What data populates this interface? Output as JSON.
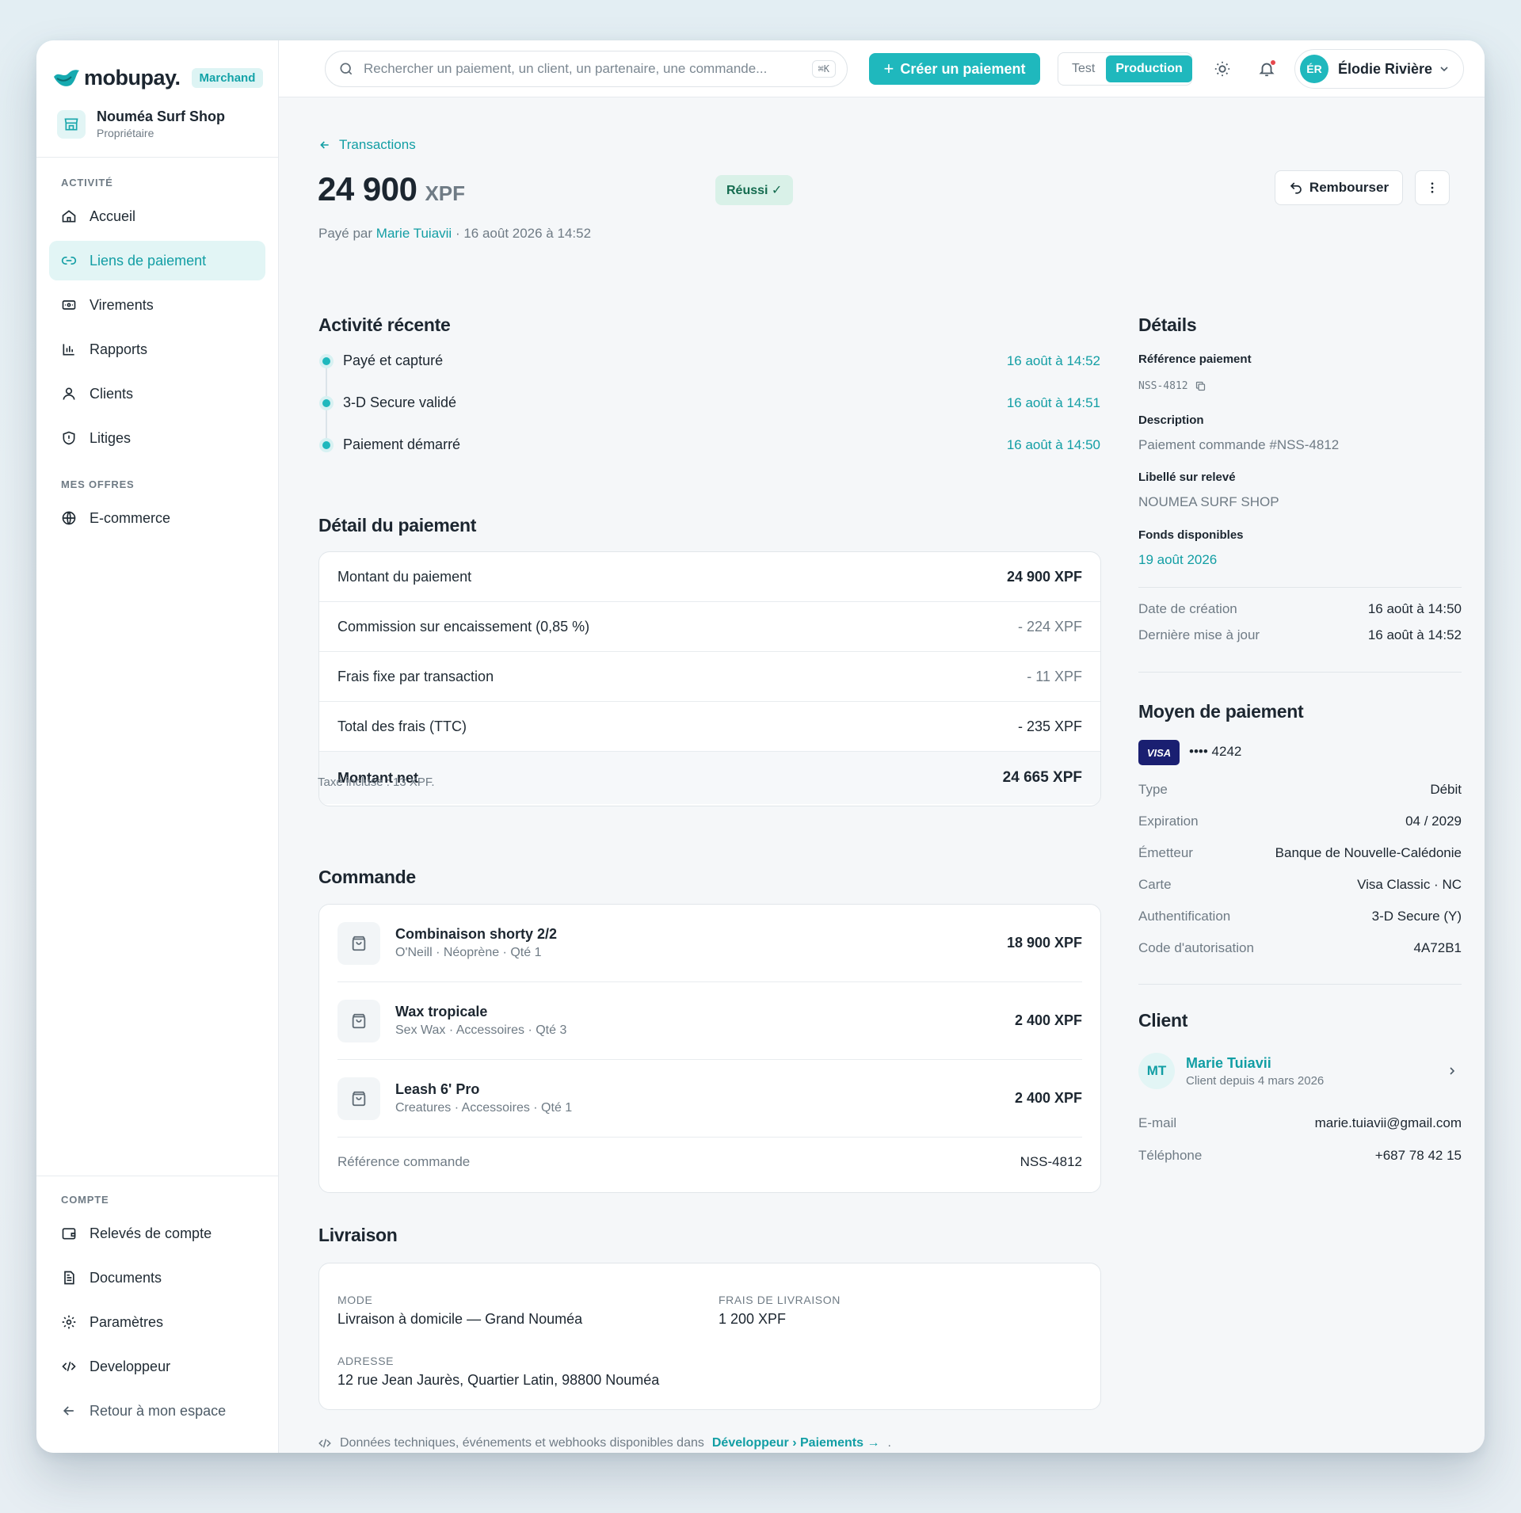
{
  "brand": {
    "name": "mobupay.",
    "badge": "Marchand"
  },
  "shop": {
    "name": "Nouméa Surf Shop",
    "role": "Propriétaire"
  },
  "sidebar": {
    "section_activity": "ACTIVITÉ",
    "items": [
      {
        "label": "Accueil",
        "icon": "home-icon"
      },
      {
        "label": "Liens de paiement",
        "icon": "link-icon",
        "active": true
      },
      {
        "label": "Virements",
        "icon": "transfer-icon"
      },
      {
        "label": "Rapports",
        "icon": "chart-icon"
      },
      {
        "label": "Clients",
        "icon": "user-icon"
      },
      {
        "label": "Litiges",
        "icon": "shield-icon"
      }
    ],
    "section_offers": "MES OFFRES",
    "offers": [
      {
        "label": "E-commerce",
        "icon": "globe-icon"
      }
    ],
    "section_account": "COMPTE",
    "account": [
      {
        "label": "Relevés de compte",
        "icon": "wallet-icon"
      },
      {
        "label": "Documents",
        "icon": "document-icon"
      },
      {
        "label": "Paramètres",
        "icon": "gear-icon"
      },
      {
        "label": "Developpeur",
        "icon": "code-icon"
      },
      {
        "label": "Retour à mon espace",
        "icon": "arrow-left-icon"
      }
    ]
  },
  "topbar": {
    "search_placeholder": "Rechercher un paiement, un client, un partenaire, une commande...",
    "search_shortcut": "⌘K",
    "create_label": "Créer un paiement",
    "mode_test": "Test",
    "mode_production": "Production",
    "user_initials": "ÉR",
    "user_name": "Élodie Rivière"
  },
  "header": {
    "back_label": "Transactions",
    "amount": "24 900",
    "currency": "XPF",
    "status": "Réussi ✓",
    "paid_by_prefix": "Payé par",
    "payer": "Marie Tuiavii",
    "paid_at": "· 16 août 2026 à 14:52",
    "refund_label": "Rembourser"
  },
  "activity": {
    "title": "Activité récente",
    "events": [
      {
        "label": "Payé et capturé",
        "time": "16 août à 14:52"
      },
      {
        "label": "3-D Secure validé",
        "time": "16 août à 14:51"
      },
      {
        "label": "Paiement démarré",
        "time": "16 août à 14:50"
      }
    ]
  },
  "payment_detail": {
    "title": "Détail du paiement",
    "rows": [
      {
        "label": "Montant du paiement",
        "value": "24 900 XPF"
      },
      {
        "label": "Commission sur encaissement (0,85 %)",
        "value": "- 224 XPF"
      },
      {
        "label": "Frais fixe par transaction",
        "value": "- 11 XPF"
      },
      {
        "label": "Total des frais (TTC)",
        "value": "- 235 XPF"
      },
      {
        "label": "Montant net",
        "value": "24 665 XPF"
      }
    ],
    "tax_note": "Taxe incluse : 13 XPF."
  },
  "order": {
    "title": "Commande",
    "items": [
      {
        "name": "Combinaison shorty 2/2",
        "sub": "O'Neill · Néoprène · Qté 1",
        "price": "18 900 XPF"
      },
      {
        "name": "Wax tropicale",
        "sub": "Sex Wax · Accessoires · Qté 3",
        "price": "2 400 XPF"
      },
      {
        "name": "Leash 6' Pro",
        "sub": "Creatures · Accessoires · Qté 1",
        "price": "2 400 XPF"
      }
    ],
    "ref_label": "Référence commande",
    "ref_value": "NSS-4812"
  },
  "delivery": {
    "title": "Livraison",
    "mode_label": "MODE",
    "mode_value": "Livraison à domicile — Grand Nouméa",
    "fee_label": "FRAIS DE LIVRAISON",
    "fee_value": "1 200 XPF",
    "address_label": "ADRESSE",
    "address_value": "12 rue Jean Jaurès, Quartier Latin, 98800 Nouméa"
  },
  "dev_note": {
    "text": "Données techniques, événements et webhooks disponibles dans",
    "link": "Développeur › Paiements →",
    "suffix": "."
  },
  "details": {
    "title": "Détails",
    "ref_label": "Référence paiement",
    "ref_value": "NSS-4812",
    "desc_label": "Description",
    "desc_value": "Paiement commande #NSS-4812",
    "statement_label": "Libellé sur relevé",
    "statement_value": "NOUMEA SURF SHOP",
    "funds_label": "Fonds disponibles",
    "funds_value": "19 août 2026",
    "created_label": "Date de création",
    "created_value": "16 août à 14:50",
    "updated_label": "Dernière mise à jour",
    "updated_value": "16 août à 14:52"
  },
  "payment_method": {
    "title": "Moyen de paiement",
    "brand": "VISA",
    "masked": "•••• 4242",
    "rows": [
      {
        "label": "Type",
        "value": "Débit"
      },
      {
        "label": "Expiration",
        "value": "04 / 2029"
      },
      {
        "label": "Émetteur",
        "value": "Banque de Nouvelle-Calédonie"
      },
      {
        "label": "Carte",
        "value": "Visa Classic · NC"
      },
      {
        "label": "Authentification",
        "value": "3-D Secure (Y)"
      },
      {
        "label": "Code d'autorisation",
        "value": "4A72B1"
      }
    ]
  },
  "client": {
    "title": "Client",
    "initials": "MT",
    "name": "Marie Tuiavii",
    "since": "Client depuis 4 mars 2026",
    "email_label": "E-mail",
    "email_value": "marie.tuiavii@gmail.com",
    "phone_label": "Téléphone",
    "phone_value": "+687 78 42 15"
  },
  "colors": {
    "accent": "#1fb8bd",
    "accent_dark": "#129ea4",
    "success_bg": "#d9f1e8",
    "visa": "#1a1f71"
  }
}
